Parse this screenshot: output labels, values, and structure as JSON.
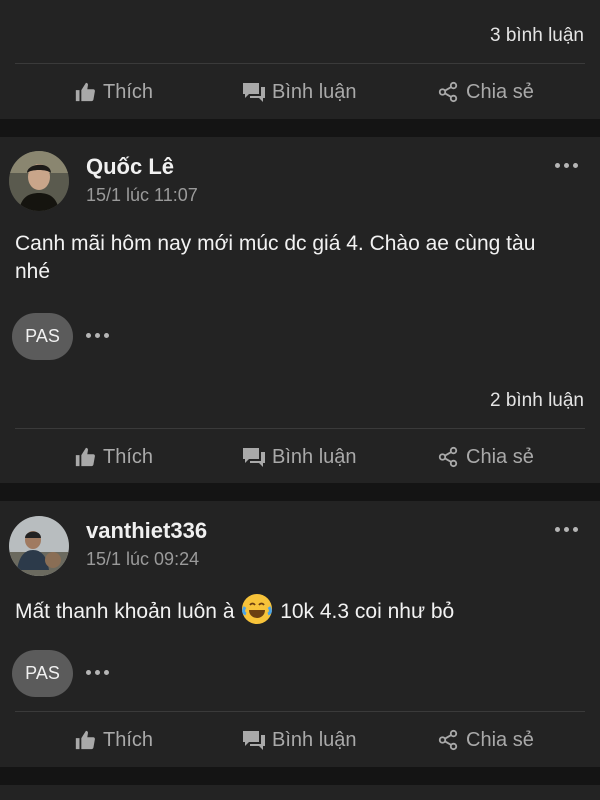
{
  "post0": {
    "comments": "3 bình luận"
  },
  "actions": {
    "like": "Thích",
    "comment": "Bình luận",
    "share": "Chia sẻ"
  },
  "post1": {
    "author": "Quốc Lê",
    "time": "15/1 lúc 11:07",
    "text": "Canh mãi hôm nay mới múc dc giá 4. Chào ae cùng tàu nhé",
    "reply_avatar": "PAS",
    "comments": "2 bình luận"
  },
  "post2": {
    "author": "vanthiet336",
    "time": "15/1 lúc 09:24",
    "text_before": "Mất thanh khoản luôn à",
    "text_after": "10k 4.3 coi như bỏ",
    "reply_avatar": "PAS"
  },
  "icons": [
    "thumbs-up-icon",
    "comment-icon",
    "share-icon",
    "more-icon",
    "laughing-emoji-icon"
  ]
}
